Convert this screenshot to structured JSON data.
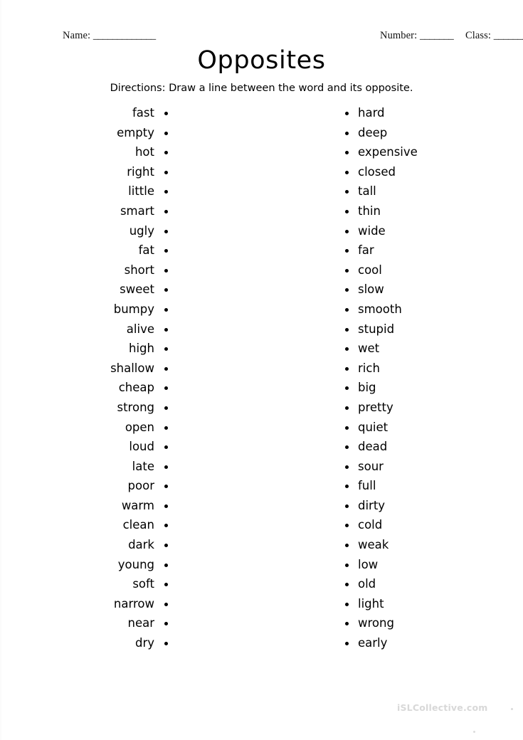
{
  "worksheet": {
    "title": "Opposites",
    "directions": "Directions: Draw a line between the word and its opposite.",
    "header": {
      "name_label": "Name:",
      "name_blank": "_____________",
      "number_label": "Number:",
      "number_blank": "_______",
      "class_label": "Class:",
      "class_blank": "_______"
    },
    "columns": {
      "left_words": [
        "fast",
        "empty",
        "hot",
        "right",
        "little",
        "smart",
        "ugly",
        "fat",
        "short",
        "sweet",
        "bumpy",
        "alive",
        "high",
        "shallow",
        "cheap",
        "strong",
        "open",
        "loud",
        "late",
        "poor",
        "warm",
        "clean",
        "dark",
        "young",
        "soft",
        "narrow",
        "near",
        "dry"
      ],
      "right_words": [
        "hard",
        "deep",
        "expensive",
        "closed",
        "tall",
        "thin",
        "wide",
        "far",
        "cool",
        "slow",
        "smooth",
        "stupid",
        "wet",
        "rich",
        "big",
        "pretty",
        "quiet",
        "dead",
        "sour",
        "full",
        "dirty",
        "cold",
        "weak",
        "low",
        "old",
        "light",
        "wrong",
        "early"
      ]
    },
    "footer": {
      "watermark": "iSLCollective.com"
    },
    "colors": {
      "text": "#000000",
      "background": "#ffffff",
      "watermark": "#d8d8d8"
    }
  }
}
